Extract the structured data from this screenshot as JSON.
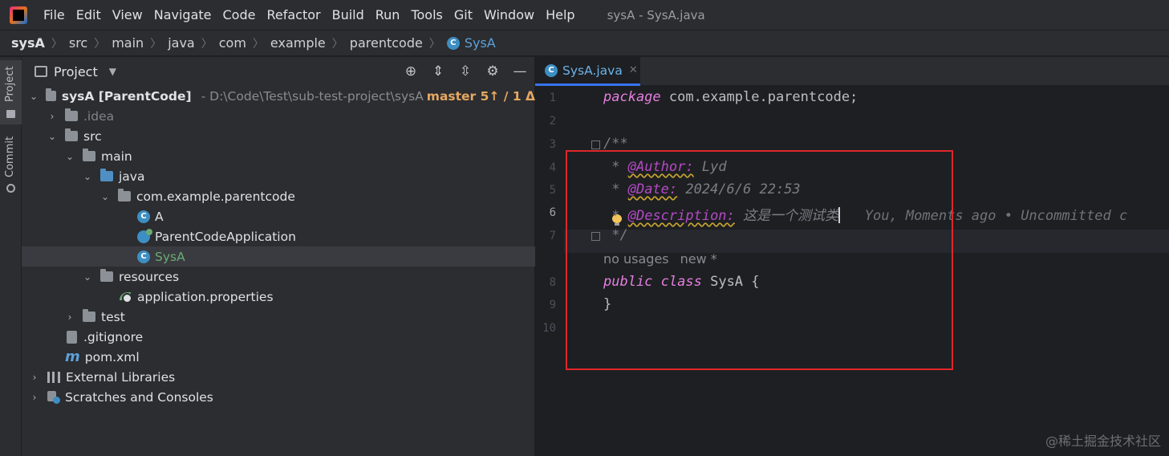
{
  "menubar": {
    "items": [
      "File",
      "Edit",
      "View",
      "Navigate",
      "Code",
      "Refactor",
      "Build",
      "Run",
      "Tools",
      "Git",
      "Window",
      "Help"
    ],
    "window_title": "sysA - SysA.java"
  },
  "breadcrumb": [
    "sysA",
    "src",
    "main",
    "java",
    "com",
    "example",
    "parentcode",
    "SysA"
  ],
  "toolstrip": {
    "project": "Project",
    "commit": "Commit"
  },
  "project_panel": {
    "title": "Project",
    "tree": {
      "root_name": "sysA [ParentCode]",
      "root_path": "- D:\\Code\\Test\\sub-test-project\\sysA",
      "root_branch": "master 5↑ / 1 Δ",
      "idea": ".idea",
      "src": "src",
      "main": "main",
      "java": "java",
      "package": "com.example.parentcode",
      "class_a": "A",
      "class_app": "ParentCodeApplication",
      "class_sysa": "SysA",
      "resources": "resources",
      "app_props": "application.properties",
      "test": "test",
      "gitignore": ".gitignore",
      "pom": "pom.xml",
      "ext_libs": "External Libraries",
      "scratches": "Scratches and Consoles"
    }
  },
  "editor": {
    "tab_label": "SysA.java",
    "line_numbers": [
      "1",
      "2",
      "3",
      "4",
      "5",
      "6",
      "7",
      "8",
      "9",
      "10"
    ],
    "code": {
      "l1_kw": "package",
      "l1_rest": " com.example.parentcode;",
      "l3": "/**",
      "l4_star": " * ",
      "l4_tag": "@Author:",
      "l4_val": " Lyd",
      "l5_star": " * ",
      "l5_tag": "@Date:",
      "l5_val": " 2024/6/6 22:53",
      "l6_star": " * ",
      "l6_tag": "@Description:",
      "l6_val": " 这是一个测试类",
      "l6_blame": "   You, Moments ago • Uncommitted c",
      "l7": " */",
      "hint_usages": "no usages",
      "hint_new": "new *",
      "l8_kw1": "public",
      "l8_kw2": "class",
      "l8_rest": " SysA {",
      "l9": "}"
    }
  },
  "watermark": "@稀土掘金技术社区"
}
